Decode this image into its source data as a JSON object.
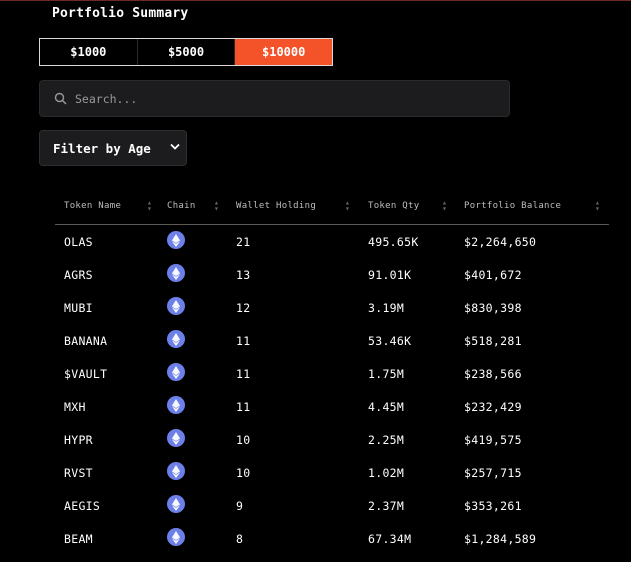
{
  "header": {
    "title": "Portfolio Summary"
  },
  "amounts": {
    "options": [
      "$1000",
      "$5000",
      "$10000"
    ],
    "selected": "$10000"
  },
  "search": {
    "placeholder": "Search..."
  },
  "filter": {
    "label": "Filter by Age"
  },
  "colors": {
    "accent": "#f4532a",
    "background": "#000000",
    "panel": "#1c1c1e",
    "eth_icon": "#6d7fe9"
  },
  "table": {
    "columns": [
      "Token Name",
      "Chain",
      "Wallet Holding",
      "Token Qty",
      "Portfolio Balance"
    ],
    "rows": [
      {
        "token": "OLAS",
        "chain_icon": "ethereum-icon",
        "holding": "21",
        "qty": "495.65K",
        "balance": "$2,264,650"
      },
      {
        "token": "AGRS",
        "chain_icon": "ethereum-icon",
        "holding": "13",
        "qty": "91.01K",
        "balance": "$401,672"
      },
      {
        "token": "MUBI",
        "chain_icon": "ethereum-icon",
        "holding": "12",
        "qty": "3.19M",
        "balance": "$830,398"
      },
      {
        "token": "BANANA",
        "chain_icon": "ethereum-icon",
        "holding": "11",
        "qty": "53.46K",
        "balance": "$518,281"
      },
      {
        "token": "$VAULT",
        "chain_icon": "ethereum-icon",
        "holding": "11",
        "qty": "1.75M",
        "balance": "$238,566"
      },
      {
        "token": "MXH",
        "chain_icon": "ethereum-icon",
        "holding": "11",
        "qty": "4.45M",
        "balance": "$232,429"
      },
      {
        "token": "HYPR",
        "chain_icon": "ethereum-icon",
        "holding": "10",
        "qty": "2.25M",
        "balance": "$419,575"
      },
      {
        "token": "RVST",
        "chain_icon": "ethereum-icon",
        "holding": "10",
        "qty": "1.02M",
        "balance": "$257,715"
      },
      {
        "token": "AEGIS",
        "chain_icon": "ethereum-icon",
        "holding": "9",
        "qty": "2.37M",
        "balance": "$353,261"
      },
      {
        "token": "BEAM",
        "chain_icon": "ethereum-icon",
        "holding": "8",
        "qty": "67.34M",
        "balance": "$1,284,589"
      }
    ]
  }
}
